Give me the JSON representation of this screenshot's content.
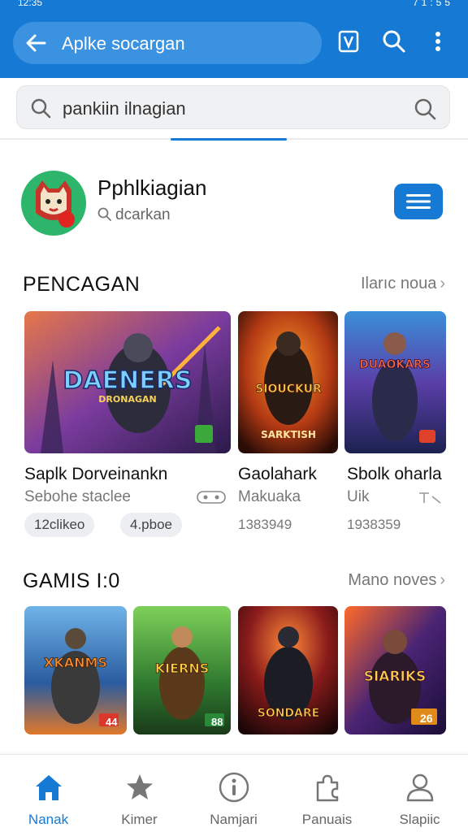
{
  "status_bar": {
    "time": "12:35",
    "right": "71:55"
  },
  "app_bar": {
    "search_text": "Aplke socargan",
    "icons": [
      "back-arrow-icon",
      "v-badge-icon",
      "search-icon",
      "more-vert-icon"
    ]
  },
  "search": {
    "value": "pankiin ilnagian"
  },
  "profile": {
    "name": "Pphlkiagian",
    "subtitle": "dcarkan"
  },
  "section1": {
    "title": "PENCAGAN",
    "more": "Ilarıc noua",
    "cards": [
      {
        "title": "Saplk Dorveinankn",
        "sub": "Sebohe staclee",
        "art_text": "DAENERS",
        "art_sub": "DRONAGAN",
        "tag1": "12clikeo",
        "tag2": "4.pboe",
        "palette": "#5b2f8a"
      },
      {
        "title": "Gaolahark",
        "sub": "Makuaka",
        "art_text": "SIOUCKUR",
        "art_sub": "SARKTISH",
        "num": "1383949",
        "palette": "#b33a14"
      },
      {
        "title": "Sbolk oharla",
        "sub": "Uik",
        "art_text": "DUAOKARS",
        "num": "1938359",
        "palette": "#2c3f8f"
      }
    ]
  },
  "section2": {
    "title": "GAMIS I:0",
    "more": "Mano noves",
    "cards": [
      {
        "art_text": "XKANMS",
        "palette": "#2a5ca0",
        "badge": "44"
      },
      {
        "art_text": "KIERNS",
        "palette": "#2f7a2f",
        "badge": "88"
      },
      {
        "art_text": "SONDARE",
        "palette": "#8a1b1b"
      },
      {
        "art_text": "SIARIKS",
        "palette": "#4a2474",
        "badge": "26"
      }
    ]
  },
  "bottom_nav": [
    {
      "label": "Nanak",
      "icon": "home-icon",
      "active": true
    },
    {
      "label": "Kimer",
      "icon": "star-icon",
      "active": false
    },
    {
      "label": "Namjari",
      "icon": "info-circle-icon",
      "active": false
    },
    {
      "label": "Panuais",
      "icon": "puzzle-icon",
      "active": false
    },
    {
      "label": "Slapiic",
      "icon": "person-icon",
      "active": false
    }
  ],
  "colors": {
    "primary": "#1679d3",
    "avatar_bg": "#2db56b"
  }
}
